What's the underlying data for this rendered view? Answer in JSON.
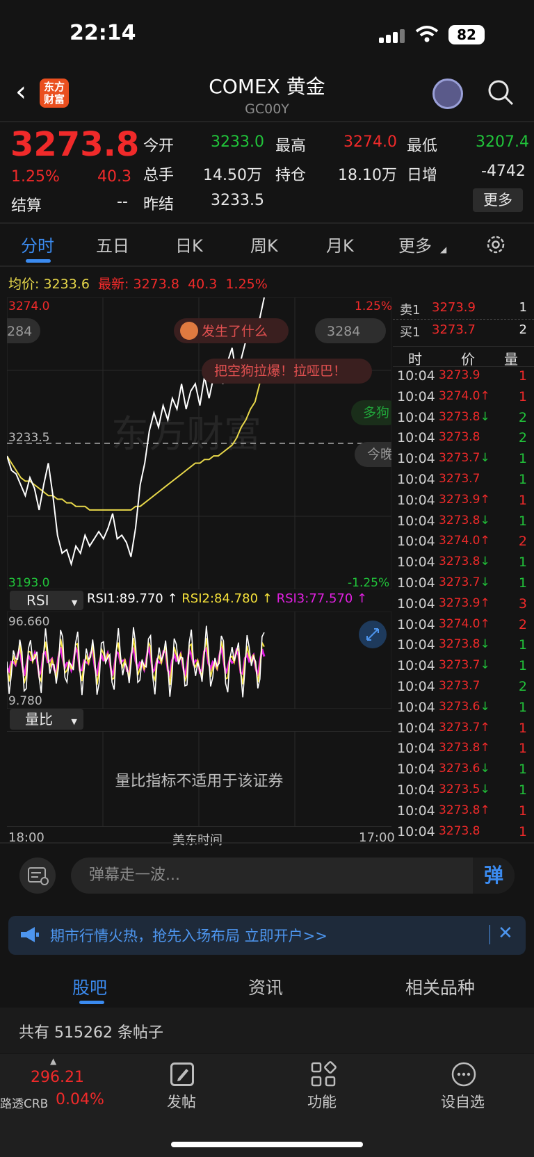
{
  "status_bar": {
    "time": "22:14",
    "battery": "82"
  },
  "header": {
    "title": "COMEX 黄金",
    "code": "GC00Y",
    "logo_text": "东方财富"
  },
  "quote": {
    "price": "3273.8",
    "change_pct": "1.25%",
    "change": "40.3",
    "settle_label": "结算",
    "settle_value": "--",
    "open_label": "今开",
    "open_value": "3233.0",
    "high_label": "最高",
    "high_value": "3274.0",
    "low_label": "最低",
    "low_value": "3207.4",
    "volume_label": "总手",
    "volume_value": "14.50万",
    "oi_label": "持仓",
    "oi_value": "18.10万",
    "daily_inc_label": "日增",
    "daily_inc_value": "-4742",
    "prev_settle_label": "昨结",
    "prev_settle_value": "3233.5",
    "more_label": "更多"
  },
  "tabs": [
    "分时",
    "五日",
    "日K",
    "周K",
    "月K",
    "更多"
  ],
  "legend": {
    "avg_label": "均价:",
    "avg_value": "3233.6",
    "latest_label": "最新:",
    "latest_value": "3273.8",
    "latest_change": "40.3",
    "latest_pct": "1.25%"
  },
  "chart_labels": {
    "top_price": "3274.0",
    "top_pct": "1.25%",
    "bottom_price": "3193.0",
    "bottom_pct": "-1.25%",
    "ref_price": "3233.5",
    "bubble_left": "284",
    "bubble_right": "3284",
    "danmaku1": "发生了什么",
    "danmaku2": "把空狗拉爆！拉哑巴！",
    "danmaku3": "多狗",
    "danmaku4": "今晚",
    "watermark": "东方财富"
  },
  "chart_data": {
    "type": "line",
    "x_range": [
      "18:00",
      "17:00"
    ],
    "ylim": [
      3193.0,
      3274.0
    ],
    "series": [
      {
        "name": "price",
        "values": [
          3230,
          3226,
          3225,
          3222,
          3219,
          3224,
          3221,
          3215,
          3222,
          3228,
          3219,
          3208,
          3203,
          3204,
          3200,
          3205,
          3203,
          3208,
          3205,
          3207,
          3209,
          3207,
          3210,
          3214,
          3207,
          3208,
          3206,
          3202,
          3210,
          3222,
          3228,
          3237,
          3242,
          3238,
          3244,
          3240,
          3246,
          3243,
          3250,
          3243,
          3248,
          3250,
          3244,
          3252,
          3246,
          3252,
          3255,
          3250,
          3256,
          3260,
          3252,
          3257,
          3262,
          3265,
          3266,
          3268,
          3274
        ]
      },
      {
        "name": "avg",
        "values": [
          3230,
          3228,
          3226,
          3224,
          3223,
          3223,
          3222,
          3221,
          3220,
          3219,
          3219,
          3218,
          3218,
          3217,
          3217,
          3216,
          3216,
          3216,
          3215,
          3215,
          3215,
          3215,
          3215,
          3215,
          3215,
          3215,
          3215,
          3215,
          3216,
          3216,
          3217,
          3218,
          3219,
          3220,
          3221,
          3222,
          3223,
          3224,
          3225,
          3226,
          3227,
          3228,
          3228,
          3229,
          3229,
          3230,
          3230,
          3231,
          3232,
          3233,
          3235,
          3238,
          3240,
          3243,
          3245,
          3250,
          3256
        ]
      }
    ]
  },
  "rsi": {
    "select_label": "RSI",
    "rsi1": "RSI1:89.770 ↑",
    "rsi2": "RSI2:84.780 ↑",
    "rsi3": "RSI3:77.570 ↑",
    "max": "96.660",
    "min": "9.780"
  },
  "volume_ratio": {
    "select_label": "量比",
    "message": "量比指标不适用于该证券"
  },
  "axis": {
    "left": "18:00",
    "mid": "美东时间",
    "right": "17:00"
  },
  "order_book": [
    {
      "label": "卖1",
      "price": "3273.9",
      "qty": "1"
    },
    {
      "label": "买1",
      "price": "3273.7",
      "qty": "2"
    }
  ],
  "ticks_header": {
    "time": "时",
    "price": "价",
    "qty": "量"
  },
  "ticks": [
    {
      "t": "10:04",
      "p": "3273.9",
      "arrow": "",
      "v": "1",
      "vc": "red"
    },
    {
      "t": "10:04",
      "p": "3274.0",
      "arrow": "↑",
      "v": "1",
      "vc": "red"
    },
    {
      "t": "10:04",
      "p": "3273.8",
      "arrow": "↓",
      "v": "2",
      "vc": "green"
    },
    {
      "t": "10:04",
      "p": "3273.8",
      "arrow": "",
      "v": "2",
      "vc": "green"
    },
    {
      "t": "10:04",
      "p": "3273.7",
      "arrow": "↓",
      "v": "1",
      "vc": "green"
    },
    {
      "t": "10:04",
      "p": "3273.7",
      "arrow": "",
      "v": "1",
      "vc": "green"
    },
    {
      "t": "10:04",
      "p": "3273.9",
      "arrow": "↑",
      "v": "1",
      "vc": "red"
    },
    {
      "t": "10:04",
      "p": "3273.8",
      "arrow": "↓",
      "v": "1",
      "vc": "green"
    },
    {
      "t": "10:04",
      "p": "3274.0",
      "arrow": "↑",
      "v": "2",
      "vc": "red"
    },
    {
      "t": "10:04",
      "p": "3273.8",
      "arrow": "↓",
      "v": "1",
      "vc": "green"
    },
    {
      "t": "10:04",
      "p": "3273.7",
      "arrow": "↓",
      "v": "1",
      "vc": "green"
    },
    {
      "t": "10:04",
      "p": "3273.9",
      "arrow": "↑",
      "v": "3",
      "vc": "red"
    },
    {
      "t": "10:04",
      "p": "3274.0",
      "arrow": "↑",
      "v": "2",
      "vc": "red"
    },
    {
      "t": "10:04",
      "p": "3273.8",
      "arrow": "↓",
      "v": "1",
      "vc": "green"
    },
    {
      "t": "10:04",
      "p": "3273.7",
      "arrow": "↓",
      "v": "1",
      "vc": "green"
    },
    {
      "t": "10:04",
      "p": "3273.7",
      "arrow": "",
      "v": "2",
      "vc": "green"
    },
    {
      "t": "10:04",
      "p": "3273.6",
      "arrow": "↓",
      "v": "1",
      "vc": "green"
    },
    {
      "t": "10:04",
      "p": "3273.7",
      "arrow": "↑",
      "v": "1",
      "vc": "red"
    },
    {
      "t": "10:04",
      "p": "3273.8",
      "arrow": "↑",
      "v": "1",
      "vc": "red"
    },
    {
      "t": "10:04",
      "p": "3273.6",
      "arrow": "↓",
      "v": "1",
      "vc": "green"
    },
    {
      "t": "10:04",
      "p": "3273.5",
      "arrow": "↓",
      "v": "1",
      "vc": "green"
    },
    {
      "t": "10:04",
      "p": "3273.8",
      "arrow": "↑",
      "v": "1",
      "vc": "red"
    },
    {
      "t": "10:04",
      "p": "3273.8",
      "arrow": "",
      "v": "1",
      "vc": "red"
    }
  ],
  "danmaku_input": {
    "placeholder": "弹幕走一波...",
    "send": "弹"
  },
  "banner": {
    "text": "期市行情火热，抢先入场布局 立即开户>>",
    "close": "✕"
  },
  "bottom_tabs": [
    "股吧",
    "资讯",
    "相关品种"
  ],
  "posts": {
    "text": "共有 515262 条帖子"
  },
  "bottom_bar": {
    "index_value": "296.21",
    "index_name": "路透CRB",
    "index_pct": "0.04%",
    "post": "发帖",
    "features": "功能",
    "watchlist": "设自选"
  },
  "colors": {
    "up": "#f02a2a",
    "down": "#21c33a",
    "accent": "#3b8bf0",
    "avg_line": "#e8d84a",
    "rsi1": "#ffffff",
    "rsi2": "#f5e13a",
    "rsi3": "#e020e0"
  }
}
